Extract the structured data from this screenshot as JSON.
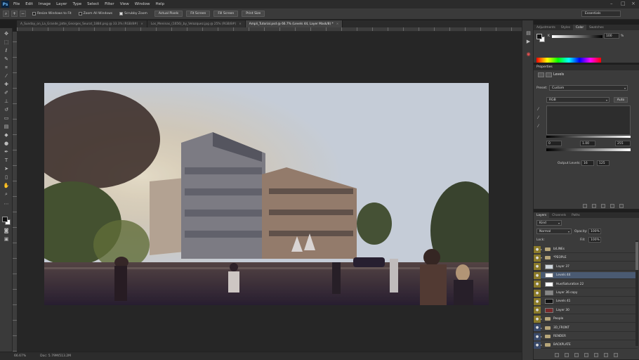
{
  "app": {
    "logo": "Ps"
  },
  "menu": [
    "File",
    "Edit",
    "Image",
    "Layer",
    "Type",
    "Select",
    "Filter",
    "View",
    "Window",
    "Help"
  ],
  "options": {
    "checks": [
      "Resize Windows to Fit",
      "Zoom All Windows",
      "Scrubby Zoom"
    ],
    "buttons": [
      "Actual Pixels",
      "Fit Screen",
      "Fill Screen",
      "Print Size"
    ],
    "workspace": "Essentials"
  },
  "tabs": [
    {
      "label": "A_Sunday_on_La_Grande_Jatte_Georges_Seurat_1884.png @ 33.3% (RGB/8#)",
      "active": false
    },
    {
      "label": "Los_Meninas_(1656)_by_Velazquez.jpg @ 25% (RGB/8#)",
      "active": false
    },
    {
      "label": "Ampli_Tutorial.psd @ 66.7% (Levels 44, Layer Mask/8) *",
      "active": true
    }
  ],
  "status": {
    "zoom": "66.67%",
    "doc": "Doc: 5.79M/513.2M"
  },
  "color_panel": {
    "tabs": [
      "Adjustments",
      "Styles",
      "Color",
      "Swatches"
    ],
    "channel": "K",
    "value": "100",
    "unit": "%"
  },
  "properties": {
    "header": "Properties",
    "title": "Levels",
    "preset_label": "Preset:",
    "preset_value": "Custom",
    "channel_value": "RGB",
    "auto_label": "Auto",
    "input_black": "0",
    "input_gamma": "1.00",
    "input_white": "255",
    "output_label": "Output Levels:",
    "output_black": "16",
    "output_white": "125"
  },
  "layers": {
    "tabs": [
      "Layers",
      "Channels",
      "Paths"
    ],
    "kind": "Kind",
    "blend": "Normal",
    "opacity_label": "Opacity:",
    "opacity": "100%",
    "lock_label": "Lock:",
    "fill_label": "Fill:",
    "fill": "100%",
    "rows": [
      {
        "name": "b/LINEs",
        "kind": "folder",
        "color": "#8a7a2a"
      },
      {
        "name": "*PEOPLE",
        "kind": "folder-open",
        "color": "#8a7a2a"
      },
      {
        "name": "Layer 37",
        "kind": "layer",
        "color": "#8a7a2a",
        "thumb": "#cfd7de"
      },
      {
        "name": "Levels 44",
        "kind": "adjust",
        "color": "#8a7a2a",
        "selected": true,
        "thumb": "#ffffff"
      },
      {
        "name": "Hue/Saturation 22",
        "kind": "adjust",
        "color": "#8a7a2a",
        "thumb": "#ffffff"
      },
      {
        "name": "Layer 36 copy",
        "kind": "layer",
        "color": "#8a7a2a",
        "thumb": "#888888"
      },
      {
        "name": "Levels 41",
        "kind": "adjust",
        "color": "#8a7a2a",
        "thumb": "#111111"
      },
      {
        "name": "Layer 30",
        "kind": "layer",
        "color": "#8a7a2a",
        "thumb": "#7a2a2a"
      },
      {
        "name": "People",
        "kind": "folder",
        "color": "#8a7a2a"
      },
      {
        "name": "3D_FRONT",
        "kind": "folder",
        "color": "#3a4a6a"
      },
      {
        "name": "RENDER",
        "kind": "folder",
        "color": "#3a4a6a"
      },
      {
        "name": "BACKPLATE",
        "kind": "folder",
        "color": "#3a4a6a"
      }
    ]
  }
}
